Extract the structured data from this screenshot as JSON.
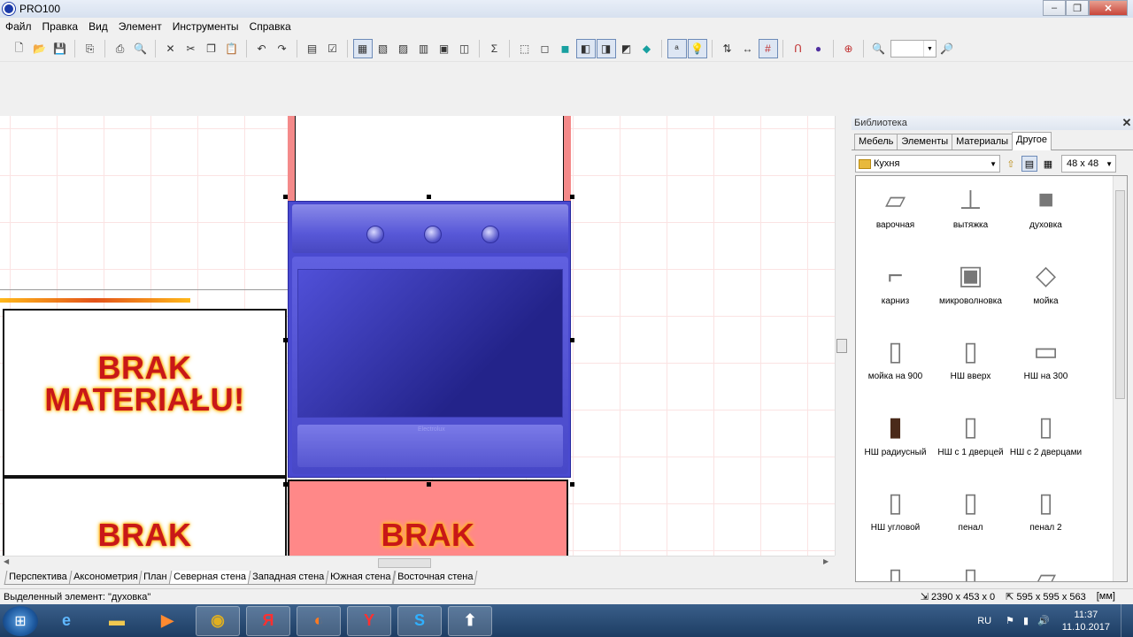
{
  "window": {
    "title": "PRO100",
    "minimize": "‒",
    "maximize": "❐",
    "close": "✕"
  },
  "menu": [
    "Файл",
    "Правка",
    "Вид",
    "Элемент",
    "Инструменты",
    "Справка"
  ],
  "toolbar": {
    "groups": [
      [
        "new-icon",
        "open-icon",
        "save-icon"
      ],
      [
        "export-icon"
      ],
      [
        "print-icon",
        "print-preview-icon"
      ],
      [
        "delete-icon",
        "cut-icon",
        "copy-icon",
        "paste-icon"
      ],
      [
        "undo-icon",
        "redo-icon"
      ],
      [
        "properties-icon",
        "checklist-icon"
      ],
      [
        "view-mode-1-icon",
        "view-mode-2-icon",
        "view-mode-3-icon",
        "view-mode-4-icon",
        "view-mode-5-icon",
        "view-mode-6-icon"
      ],
      [
        "sum-icon"
      ],
      [
        "cube-1-icon",
        "cube-2-icon",
        "cube-3-icon",
        "cube-4-icon",
        "cube-5-icon",
        "cube-6-icon",
        "cube-7-icon"
      ],
      [
        "text-mode-icon",
        "light-icon"
      ],
      [
        "align-icon",
        "dimension-icon",
        "grid-icon"
      ],
      [
        "magnet-icon",
        "sphere-icon"
      ],
      [
        "target-icon"
      ],
      [
        "zoom-in-icon"
      ]
    ],
    "zoom_value": "",
    "zoom_out": "zoom-out-icon"
  },
  "canvas": {
    "brak_1_line1": "BRAK",
    "brak_1_line2": "MATERIAŁU!",
    "brak_2": "BRAK",
    "brak_3": "BRAK",
    "oven_brand": "Electrolux"
  },
  "view_tabs": [
    "Перспектива",
    "Аксонометрия",
    "План",
    "Северная стена",
    "Западная стена",
    "Южная стена",
    "Восточная стена"
  ],
  "active_view_tab": "Северная стена",
  "status": {
    "selected": "Выделенный элемент: \"духовка\"",
    "pos": "2390 x 453 x 0",
    "size": "595 x 595 x 563",
    "units": "[мм]"
  },
  "library": {
    "title": "Библиотека",
    "tabs": [
      "Мебель",
      "Элементы",
      "Материалы",
      "Другое"
    ],
    "active_tab": "Другое",
    "folder": "Кухня",
    "size": "48 x  48",
    "items": [
      {
        "label": "варочная",
        "icon": "cooktop-icon"
      },
      {
        "label": "вытяжка",
        "icon": "hood-icon"
      },
      {
        "label": "духовка",
        "icon": "oven-icon"
      },
      {
        "label": "карниз",
        "icon": "cornice-icon"
      },
      {
        "label": "микроволновка",
        "icon": "microwave-icon"
      },
      {
        "label": "мойка",
        "icon": "sink-icon"
      },
      {
        "label": "мойка на 900",
        "icon": "sink-cabinet-icon"
      },
      {
        "label": "НШ вверх",
        "icon": "cabinet-up-icon"
      },
      {
        "label": "НШ на 300",
        "icon": "cabinet-300-icon"
      },
      {
        "label": "НШ радиусный",
        "icon": "cabinet-radius-icon"
      },
      {
        "label": "НШ с 1 дверцей",
        "icon": "cabinet-1door-icon"
      },
      {
        "label": "НШ с 2 дверцами",
        "icon": "cabinet-2door-icon"
      },
      {
        "label": "НШ угловой",
        "icon": "cabinet-corner-icon"
      },
      {
        "label": "пенал",
        "icon": "tall-cabinet-icon"
      },
      {
        "label": "пенал 2",
        "icon": "tall-cabinet-2-icon"
      },
      {
        "label": "",
        "icon": "cabinet-a-icon"
      },
      {
        "label": "",
        "icon": "cabinet-b-icon"
      },
      {
        "label": "",
        "icon": "panel-icon"
      }
    ]
  },
  "taskbar": {
    "apps": [
      "ie-icon",
      "explorer-icon",
      "media-icon",
      "chrome-icon",
      "yandex-browser-icon",
      "firefox-icon",
      "yandex-icon",
      "skype-icon",
      "upload-icon"
    ],
    "yandex_label": "Я",
    "y_label": "Y",
    "skype_label": "S",
    "lang": "RU",
    "time": "11:37",
    "date": "11.10.2017"
  },
  "colors": {
    "accent": "#4a4ad0",
    "selection_pink": "#f48a8a",
    "brak_red": "#c81818"
  }
}
